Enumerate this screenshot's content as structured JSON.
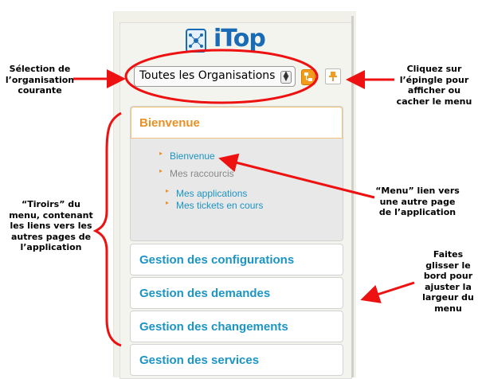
{
  "logo": {
    "text": "iTop"
  },
  "org_selector": {
    "value": "Toutes les Organisations"
  },
  "drawers": [
    {
      "title": "Bienvenue"
    },
    {
      "title": "Gestion des configurations"
    },
    {
      "title": "Gestion des demandes"
    },
    {
      "title": "Gestion des changements"
    },
    {
      "title": "Gestion des services"
    }
  ],
  "menu": {
    "bienvenue": "Bienvenue",
    "group": "Mes raccourcis",
    "sub1": "Mes applications",
    "sub2": "Mes tickets en cours"
  },
  "annotations": {
    "org_1": "Sélection de",
    "org_2": "l’organisation",
    "org_3": "courante",
    "pin_1": "Cliquez sur",
    "pin_2": "l’épingle pour",
    "pin_3": "afficher ou",
    "pin_4": "cacher le menu",
    "drawers_1": "“Tiroirs” du",
    "drawers_2": "menu, contenant",
    "drawers_3": "les liens vers les",
    "drawers_4": "autres pages de",
    "drawers_5": "l’application",
    "menu_1": "“Menu” lien vers",
    "menu_2": "une autre page",
    "menu_3": "de l’application",
    "resize_1": "Faites",
    "resize_2": "glisser le",
    "resize_3": "bord pour",
    "resize_4": "ajuster la",
    "resize_5": "largeur du",
    "resize_6": "menu"
  },
  "colors": {
    "accent": "#e89126",
    "link": "#1c94c4",
    "annotation": "#ee1111"
  }
}
